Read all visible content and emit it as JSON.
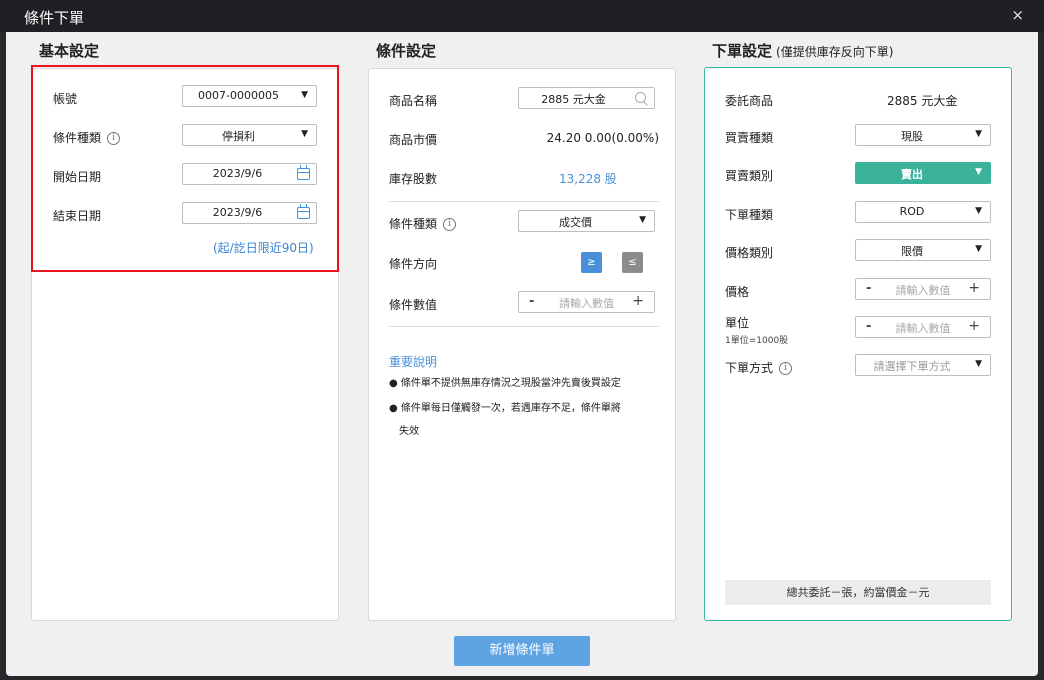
{
  "window": {
    "title": "條件下單",
    "close_icon": "×"
  },
  "basic": {
    "title": "基本設定",
    "account_label": "帳號",
    "account_value": "0007-0000005",
    "condition_type_label": "條件種類",
    "condition_type_value": "停損利",
    "start_date_label": "開始日期",
    "start_date_value": "2023/9/6",
    "end_date_label": "結束日期",
    "end_date_value": "2023/9/6",
    "date_limit_note": "(起/訖日限近90日)"
  },
  "condition": {
    "title": "條件設定",
    "product_label": "商品名稱",
    "product_value": "2885 元大金",
    "price_label": "商品市價",
    "price_value": "24.20 0.00(0.00%)",
    "stock_label": "庫存股數",
    "stock_value": "13,228 股",
    "type_label": "條件種類",
    "type_value": "成交價",
    "direction_label": "條件方向",
    "direction_ge": "≥",
    "direction_le": "≤",
    "value_label": "條件數值",
    "value_placeholder": "請輸入數值",
    "minus": "-",
    "plus": "+",
    "note_title": "重要說明",
    "note_1": "● 條件單不提供無庫存情況之現股當沖先賣後買設定",
    "note_2": "● 條件單每日僅觸發一次，若遇庫存不足，條件單將",
    "note_3": "失效"
  },
  "order": {
    "title": "下單設定",
    "subtitle": "(僅提供庫存反向下單)",
    "product_label": "委託商品",
    "product_value": "2885 元大金",
    "trade_type_label": "買賣種類",
    "trade_type_value": "現股",
    "side_label": "買賣類別",
    "side_value": "賣出",
    "order_type_label": "下單種類",
    "order_type_value": "ROD",
    "price_type_label": "價格類別",
    "price_type_value": "限價",
    "price_label": "價格",
    "price_placeholder": "請輸入數值",
    "unit_label": "單位",
    "unit_note": "1單位=1000股",
    "unit_placeholder": "請輸入數值",
    "method_label": "下單方式",
    "method_placeholder": "請選擇下單方式",
    "minus": "-",
    "plus": "+",
    "total_text": "總共委託－張，約當價金－元"
  },
  "footer": {
    "submit_label": "新增條件單"
  },
  "colors": {
    "accent_blue": "#4a90d9",
    "sell_green": "#3bb39b",
    "highlight_red": "#e8141b",
    "submit_blue": "#5fa3e3"
  }
}
